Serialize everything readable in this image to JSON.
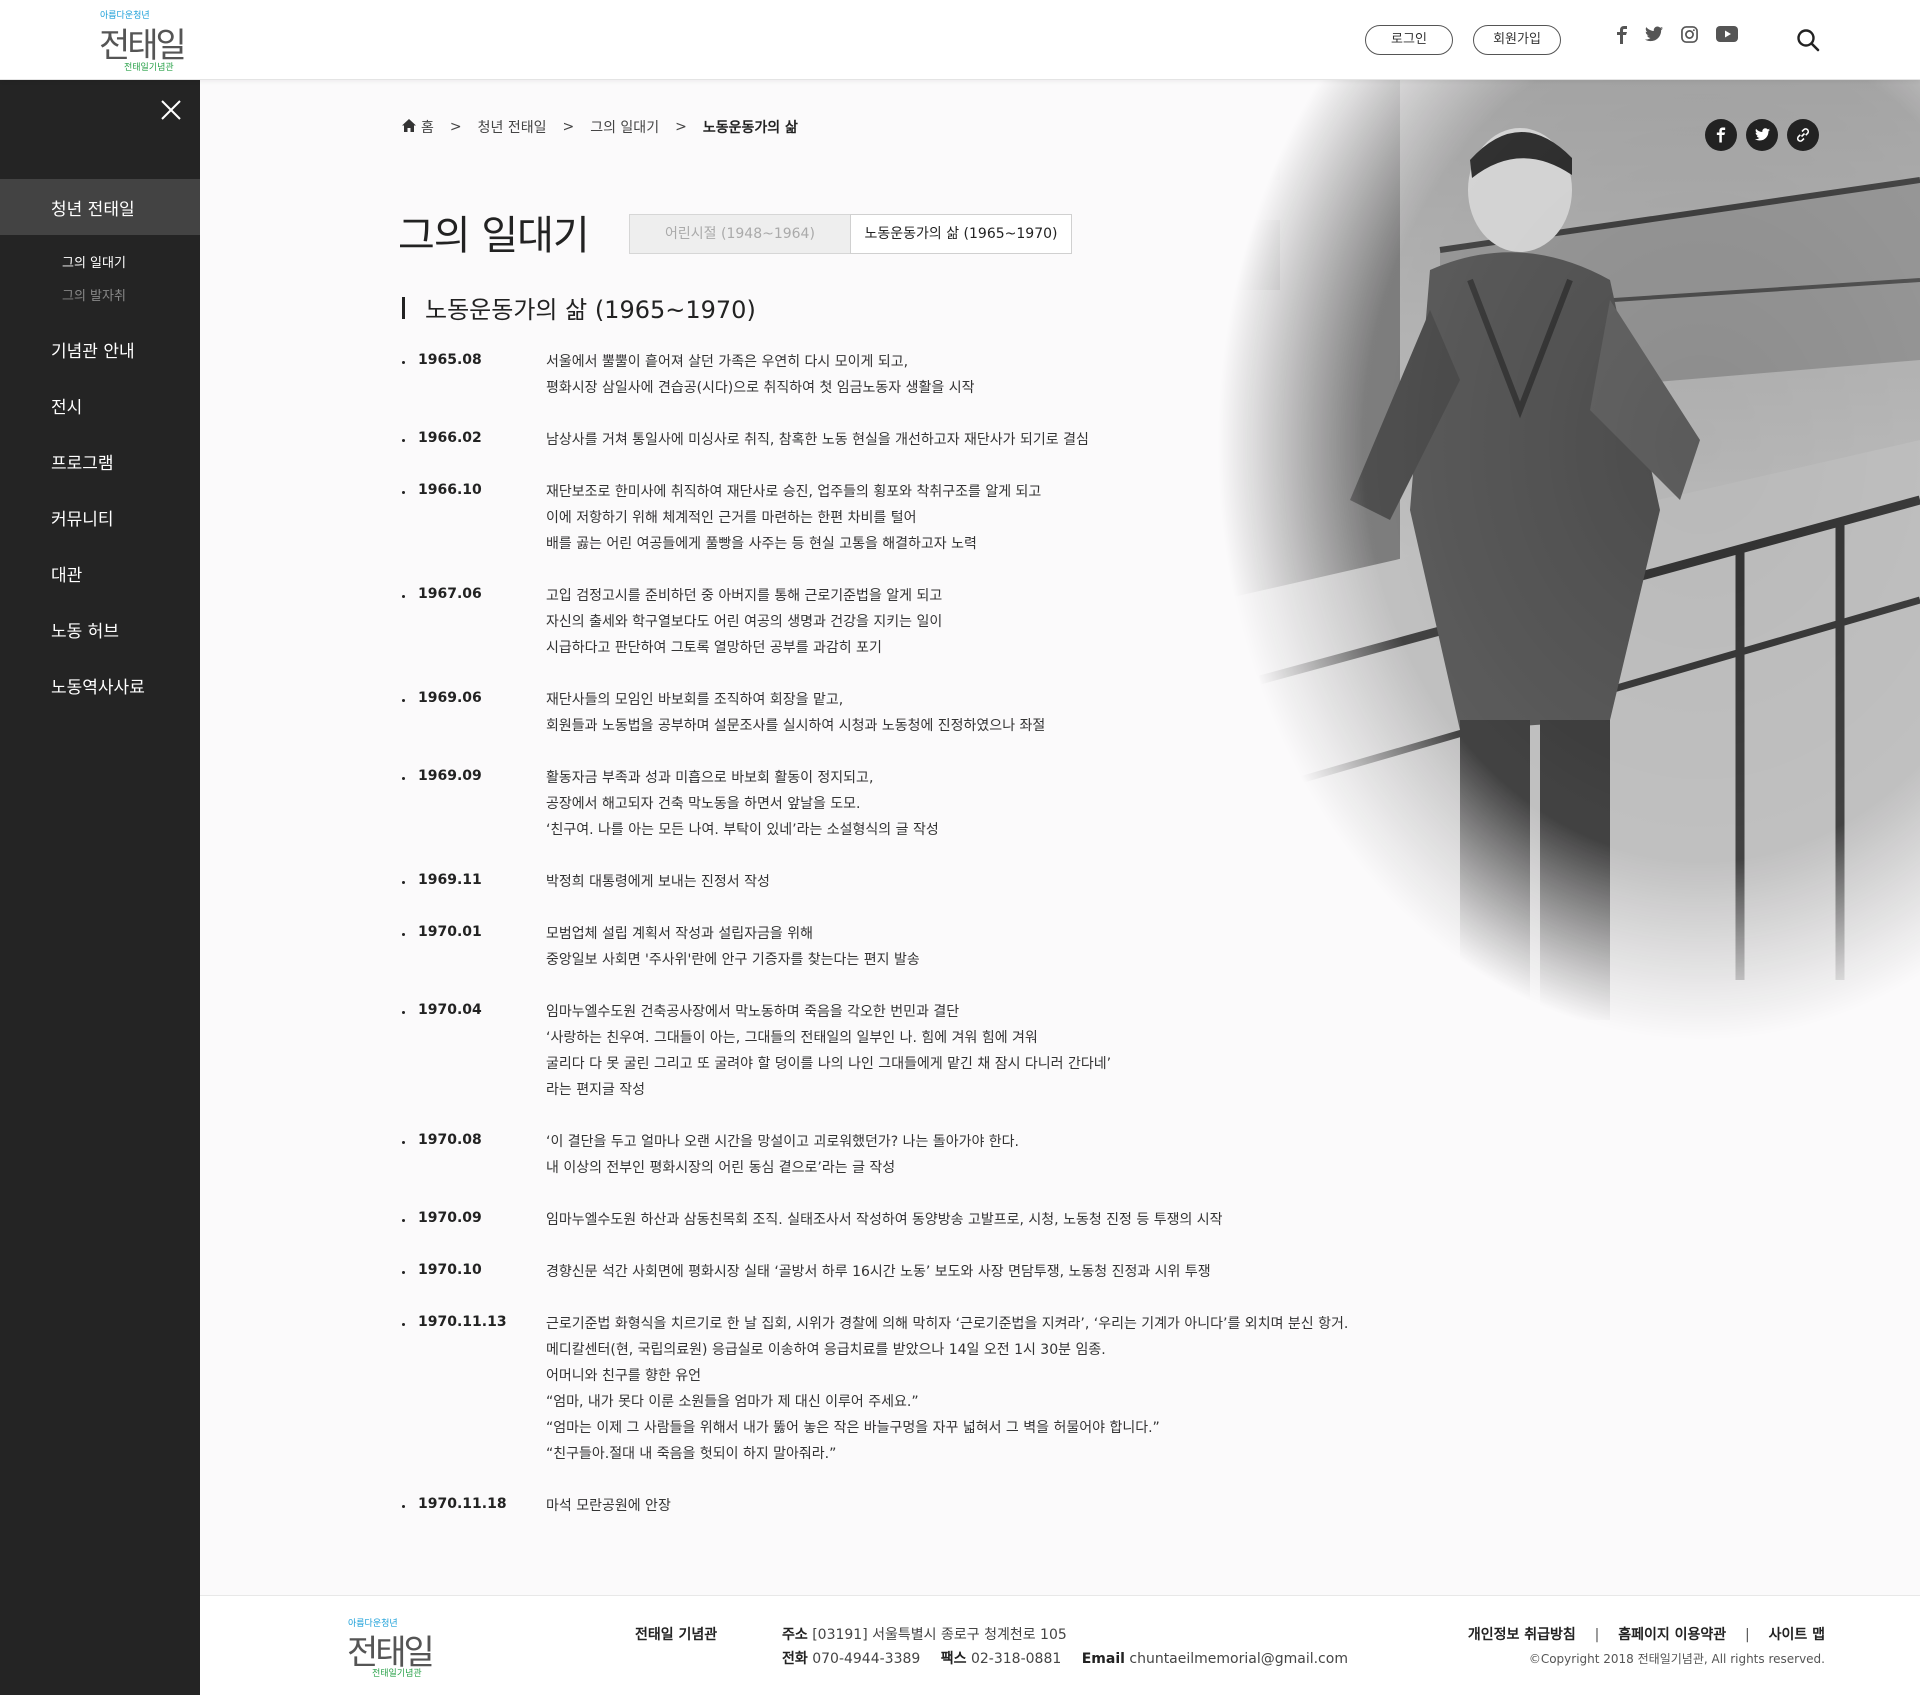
{
  "header": {
    "logo": {
      "sub": "아름다운청년",
      "main": "전태일",
      "bottom": "전태일기념관"
    },
    "login_label": "로그인",
    "signup_label": "회원가입",
    "sns": [
      "facebook-icon",
      "twitter-icon",
      "instagram-icon",
      "youtube-icon"
    ]
  },
  "sidebar": {
    "active_label": "청년 전태일",
    "subs": [
      "그의 일대기",
      "그의 발자취"
    ],
    "items": [
      "기념관 안내",
      "전시",
      "프로그램",
      "커뮤니티",
      "대관",
      "노동 허브",
      "노동역사사료"
    ]
  },
  "breadcrumb": {
    "home": "홈",
    "sep": ">",
    "level1": "청년 전태일",
    "level2": "그의 일대기",
    "current": "노동운동가의 삶"
  },
  "page_title": "그의 일대기",
  "tabs": [
    "어린시절 (1948~1964)",
    "노동운동가의 삶 (1965~1970)"
  ],
  "section_title": "노동운동가의 삶 (1965~1970)",
  "timeline": [
    {
      "date": "1965.08",
      "lines": [
        "서울에서 뿔뿔이 흩어져 살던 가족은 우연히 다시 모이게 되고,",
        "평화시장 삼일사에 견습공(시다)으로 취직하여 첫 임금노동자 생활을 시작"
      ]
    },
    {
      "date": "1966.02",
      "lines": [
        "남상사를 거쳐 통일사에 미싱사로 취직, 참혹한 노동 현실을 개선하고자 재단사가 되기로 결심"
      ]
    },
    {
      "date": "1966.10",
      "lines": [
        "재단보조로 한미사에 취직하여 재단사로 승진, 업주들의 횡포와 착취구조를 알게 되고",
        "이에 저항하기 위해 체계적인 근거를 마련하는 한편 차비를 털어",
        "배를 곯는 어린 여공들에게 풀빵을 사주는 등 현실 고통을 해결하고자 노력"
      ]
    },
    {
      "date": "1967.06",
      "lines": [
        "고입 검정고시를 준비하던 중 아버지를 통해 근로기준법을 알게 되고",
        "자신의 출세와 학구열보다도 어린 여공의 생명과 건강을 지키는 일이",
        "시급하다고 판단하여 그토록 열망하던 공부를 과감히 포기"
      ]
    },
    {
      "date": "1969.06",
      "lines": [
        "재단사들의 모임인 바보회를 조직하여 회장을 맡고,",
        "회원들과 노동법을 공부하며 설문조사를 실시하여 시청과 노동청에 진정하였으나 좌절"
      ]
    },
    {
      "date": "1969.09",
      "lines": [
        "활동자금 부족과 성과 미흡으로 바보회 활동이 정지되고,",
        "공장에서 해고되자 건축 막노동을 하면서 앞날을 도모.",
        "‘친구여. 나를 아는 모든 나여. 부탁이 있네’라는 소설형식의 글 작성"
      ]
    },
    {
      "date": "1969.11",
      "lines": [
        "박정희 대통령에게 보내는 진정서 작성"
      ]
    },
    {
      "date": "1970.01",
      "lines": [
        "모범업체 설립 계획서 작성과 설립자금을 위해",
        "중앙일보 사회면 '주사위'란에 안구 기증자를 찾는다는 편지 발송"
      ]
    },
    {
      "date": "1970.04",
      "lines": [
        "임마누엘수도원 건축공사장에서 막노동하며 죽음을 각오한 번민과 결단",
        "‘사랑하는 친우여. 그대들이 아는, 그대들의 전태일의 일부인 나. 힘에 겨워 힘에 겨워",
        "굴리다 다 못 굴린 그리고 또 굴려야 할 덩이를 나의 나인 그대들에게 맡긴 채 잠시 다니러 간다네’",
        "라는 편지글 작성"
      ]
    },
    {
      "date": "1970.08",
      "lines": [
        "‘이 결단을 두고 얼마나 오랜 시간을 망설이고 괴로워했던가? 나는 돌아가야 한다.",
        "내 이상의 전부인 평화시장의 어린 동심 곁으로’라는 글 작성"
      ]
    },
    {
      "date": "1970.09",
      "lines": [
        "임마누엘수도원 하산과 삼동친목회 조직. 실태조사서 작성하여 동양방송 고발프로, 시청, 노동청 진정 등 투쟁의 시작"
      ]
    },
    {
      "date": "1970.10",
      "lines": [
        "경향신문 석간 사회면에 평화시장 실태 ‘골방서 하루 16시간 노동’ 보도와 사장 면담투쟁, 노동청 진정과 시위 투쟁"
      ]
    },
    {
      "date": "1970.11.13",
      "lines": [
        "근로기준법 화형식을 치르기로 한 날 집회, 시위가 경찰에 의해 막히자 ‘근로기준법을 지켜라’, ‘우리는 기계가 아니다’를 외치며 분신 항거.",
        "메디칼센터(현, 국립의료원) 응급실로 이송하여 응급치료를 받았으나 14일 오전 1시 30분 임종.",
        "어머니와 친구를 향한 유언",
        "“엄마, 내가 못다 이룬 소원들을 엄마가 제 대신 이루어 주세요.”",
        "“엄마는 이제 그 사람들을 위해서 내가 뚫어 놓은 작은 바늘구멍을 자꾸 넓혀서 그 벽을 허물어야 합니다.”",
        "“친구들아.절대 내 죽음을 헛되이 하지 말아줘라.”"
      ]
    },
    {
      "date": "1970.11.18",
      "lines": [
        "마석 모란공원에 안장"
      ]
    }
  ],
  "footer": {
    "name": "전태일 기념관",
    "address_label": "주소",
    "address": "[03191] 서울특별시 종로구 청계천로 105",
    "tel_label": "전화",
    "tel": "070-4944-3389",
    "fax_label": "팩스",
    "fax": "02-318-0881",
    "email_label": "Email",
    "email": "chuntaeilmemorial@gmail.com",
    "links": [
      "개인정보 취급방침",
      "홈페이지 이용약관",
      "사이트 맵"
    ],
    "link_sep": "|",
    "copyright": "©Copyright 2018 전태일기념관, All rights reserved."
  }
}
